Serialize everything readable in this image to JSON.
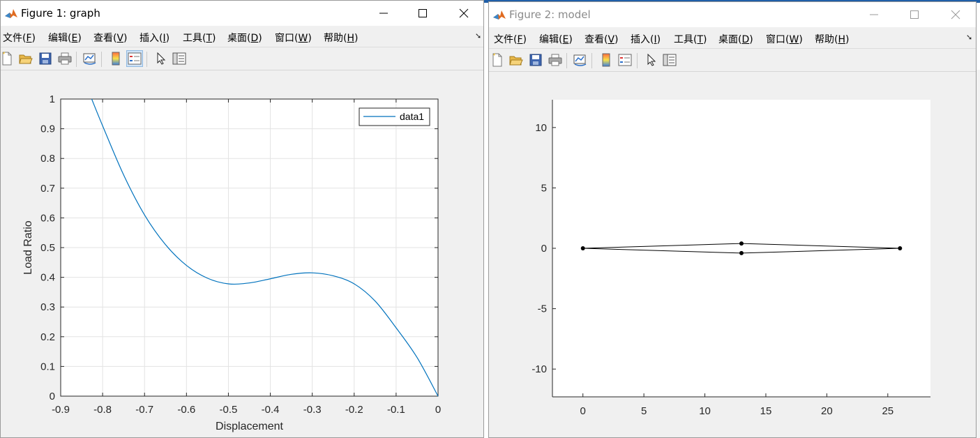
{
  "figure1": {
    "title": "Figure 1: graph",
    "menu": [
      {
        "label": "文件(",
        "key": "F",
        "tail": ")"
      },
      {
        "label": "编辑(",
        "key": "E",
        "tail": ")"
      },
      {
        "label": "查看(",
        "key": "V",
        "tail": ")"
      },
      {
        "label": "插入(",
        "key": "I",
        "tail": ")"
      },
      {
        "label": "工具(",
        "key": "T",
        "tail": ")"
      },
      {
        "label": "桌面(",
        "key": "D",
        "tail": ")"
      },
      {
        "label": "窗口(",
        "key": "W",
        "tail": ")"
      },
      {
        "label": "帮助(",
        "key": "H",
        "tail": ")"
      }
    ]
  },
  "figure2": {
    "title": "Figure 2: model",
    "menu": [
      {
        "label": "文件(",
        "key": "F",
        "tail": ")"
      },
      {
        "label": "编辑(",
        "key": "E",
        "tail": ")"
      },
      {
        "label": "查看(",
        "key": "V",
        "tail": ")"
      },
      {
        "label": "插入(",
        "key": "I",
        "tail": ")"
      },
      {
        "label": "工具(",
        "key": "T",
        "tail": ")"
      },
      {
        "label": "桌面(",
        "key": "D",
        "tail": ")"
      },
      {
        "label": "窗口(",
        "key": "W",
        "tail": ")"
      },
      {
        "label": "帮助(",
        "key": "H",
        "tail": ")"
      }
    ]
  },
  "toolbar_icons": [
    "new-file-icon",
    "open-file-icon",
    "save-icon",
    "print-icon",
    "link-plot-icon",
    "colorbar-icon",
    "legend-icon",
    "pointer-icon",
    "property-editor-icon"
  ],
  "colors": {
    "line": "#0072bd",
    "model_line": "#000000",
    "accent_pressed": "#cfe3f7"
  },
  "chart_data": [
    {
      "type": "line",
      "title": "",
      "xlabel": "Displacement",
      "ylabel": "Load Ratio",
      "xlim": [
        -0.9,
        0
      ],
      "ylim": [
        0,
        1
      ],
      "xticks": [
        -0.9,
        -0.8,
        -0.7,
        -0.6,
        -0.5,
        -0.4,
        -0.3,
        -0.2,
        -0.1,
        0
      ],
      "yticks": [
        0,
        0.1,
        0.2,
        0.3,
        0.4,
        0.5,
        0.6,
        0.7,
        0.8,
        0.9,
        1
      ],
      "grid": true,
      "legend": "top-right",
      "series": [
        {
          "name": "data1",
          "x": [
            -0.826,
            -0.8,
            -0.75,
            -0.7,
            -0.65,
            -0.6,
            -0.55,
            -0.5,
            -0.45,
            -0.4,
            -0.35,
            -0.3,
            -0.25,
            -0.2,
            -0.15,
            -0.1,
            -0.05,
            0
          ],
          "y": [
            1.0,
            0.91,
            0.745,
            0.61,
            0.51,
            0.44,
            0.397,
            0.378,
            0.381,
            0.395,
            0.41,
            0.415,
            0.405,
            0.378,
            0.32,
            0.23,
            0.13,
            0.0
          ]
        }
      ]
    },
    {
      "type": "line",
      "title": "",
      "xlabel": "",
      "ylabel": "",
      "xlim": [
        -2.5,
        28.5
      ],
      "ylim": [
        -12.3,
        12.3
      ],
      "xticks": [
        0,
        5,
        10,
        15,
        20,
        25
      ],
      "yticks": [
        -10,
        -5,
        0,
        5,
        10
      ],
      "grid": false,
      "legend": "none",
      "nodes": [
        [
          0,
          0
        ],
        [
          13,
          0.4
        ],
        [
          13,
          -0.4
        ],
        [
          26,
          0
        ]
      ],
      "segments": [
        [
          [
            0,
            0
          ],
          [
            13,
            0.4
          ]
        ],
        [
          [
            13,
            0.4
          ],
          [
            26,
            0
          ]
        ],
        [
          [
            0,
            0
          ],
          [
            13,
            -0.4
          ]
        ],
        [
          [
            13,
            -0.4
          ],
          [
            26,
            0
          ]
        ]
      ]
    }
  ]
}
